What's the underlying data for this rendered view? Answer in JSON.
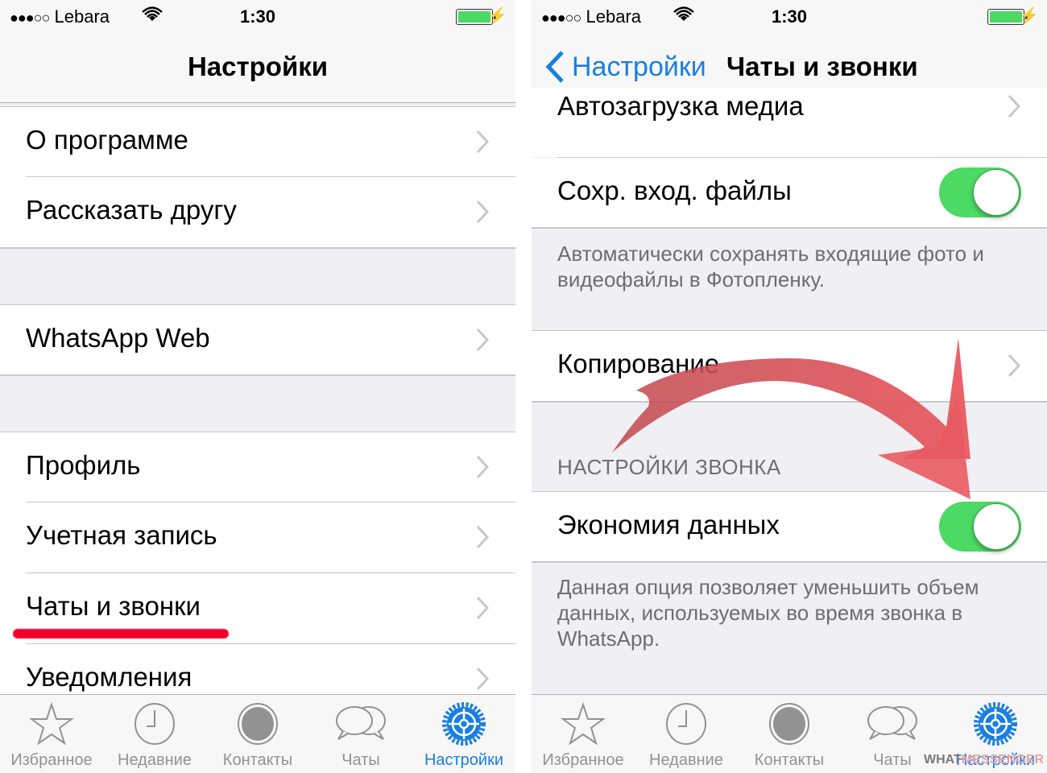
{
  "left_screen": {
    "status": {
      "signal_dots": "●●●○○",
      "carrier": "Lebara",
      "time": "1:30",
      "battery_color": "#4cd964"
    },
    "nav": {
      "title": "Настройки"
    },
    "rows": [
      {
        "label": "О программе"
      },
      {
        "label": "Рассказать другу"
      },
      {
        "label": "WhatsApp Web"
      },
      {
        "label": "Профиль"
      },
      {
        "label": "Учетная запись"
      },
      {
        "label": "Чаты и звонки",
        "highlighted": true
      },
      {
        "label": "Уведомления"
      }
    ],
    "highlight_color": "#f0002a"
  },
  "right_screen": {
    "status": {
      "signal_dots": "●●●○○",
      "carrier": "Lebara",
      "time": "1:30",
      "battery_color": "#4cd964"
    },
    "nav": {
      "back_label": "Настройки",
      "title": "Чаты и звонки"
    },
    "rows": [
      {
        "label": "Автозагрузка медиа",
        "type": "disclosure"
      },
      {
        "label": "Сохр. вход. файлы",
        "type": "toggle",
        "on": true
      },
      {
        "label": "Копирование",
        "type": "disclosure"
      },
      {
        "label": "Экономия данных",
        "type": "toggle",
        "on": true
      }
    ],
    "save_files_footer": "Автоматически сохранять входящие фото и видеофайлы в Фотопленку.",
    "call_section_header": "НАСТРОЙКИ ЗВОНКА",
    "data_saving_footer": "Данная опция позволяет уменьшить объем данных, используемых во время звонка в WhatsApp.",
    "toggle_color": "#4cd964",
    "annotation_arrow_color": "#e35a5f"
  },
  "tabbar": {
    "items": [
      {
        "label": "Избранное",
        "icon": "star-icon"
      },
      {
        "label": "Недавние",
        "icon": "clock-icon"
      },
      {
        "label": "Контакты",
        "icon": "contact-icon"
      },
      {
        "label": "Чаты",
        "icon": "chat-bubbles-icon"
      },
      {
        "label": "Настройки",
        "icon": "gear-icon",
        "active": true
      }
    ],
    "active_color": "#1a7fe0"
  },
  "watermark": {
    "part1": "WHAT",
    "part2": "MESSENGER"
  }
}
